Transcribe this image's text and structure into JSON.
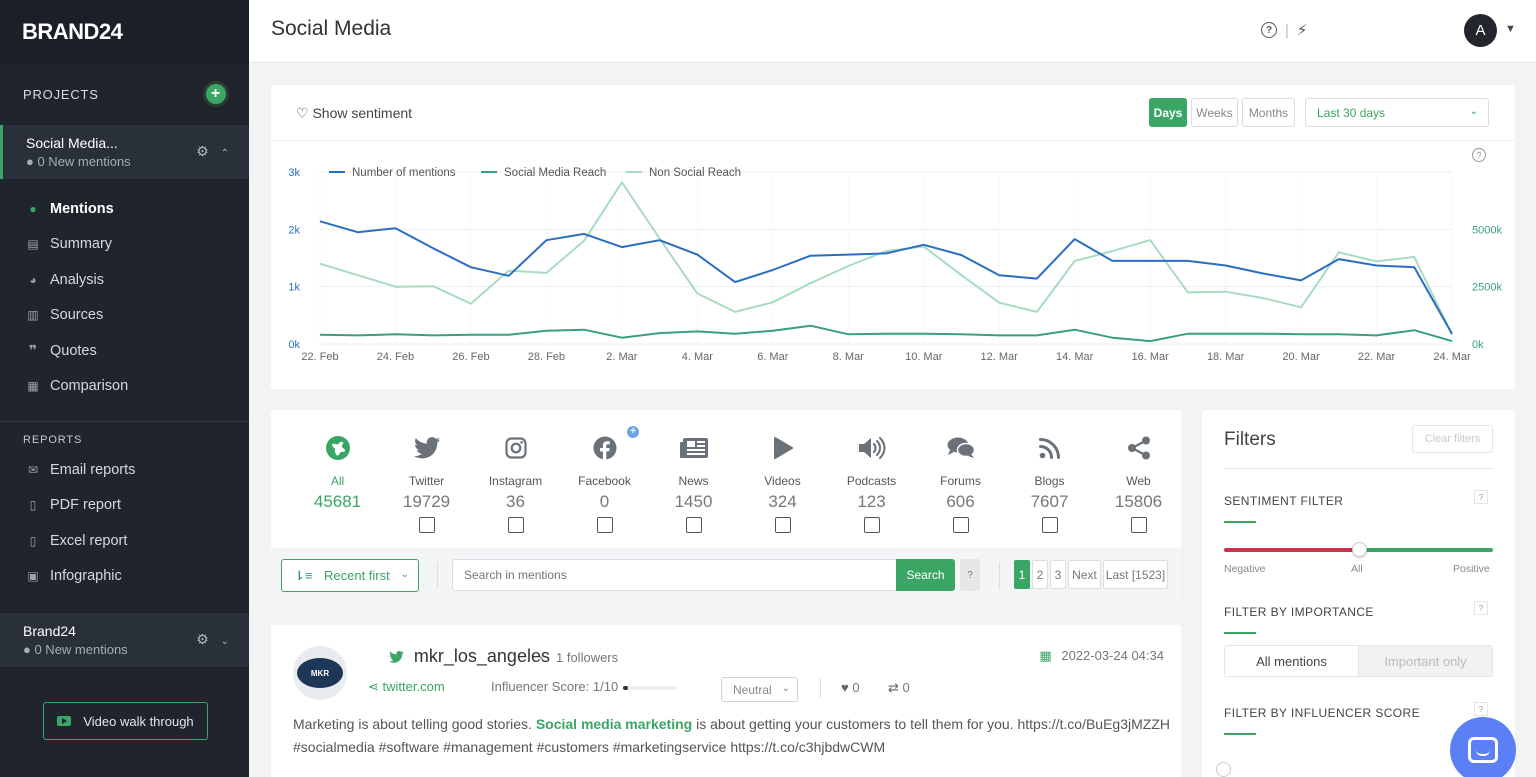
{
  "sidebar": {
    "logo": "BRAND24",
    "projects_head": "PROJECTS",
    "add_symbol": "+",
    "project1": {
      "name": "Social Media...",
      "mentions": "● 0 New mentions"
    },
    "nav": [
      {
        "label": "Mentions",
        "icon": "chat-icon"
      },
      {
        "label": "Summary",
        "icon": "document-icon"
      },
      {
        "label": "Analysis",
        "icon": "pie-chart-icon"
      },
      {
        "label": "Sources",
        "icon": "columns-icon"
      },
      {
        "label": "Quotes",
        "icon": "quote-icon"
      },
      {
        "label": "Comparison",
        "icon": "compare-icon"
      }
    ],
    "reports_head": "REPORTS",
    "reports": [
      {
        "label": "Email reports",
        "icon": "envelope-icon"
      },
      {
        "label": "PDF report",
        "icon": "pdf-icon"
      },
      {
        "label": "Excel report",
        "icon": "excel-icon"
      },
      {
        "label": "Infographic",
        "icon": "image-icon"
      }
    ],
    "project2": {
      "name": "Brand24",
      "mentions": "● 0 New mentions"
    },
    "video_label": "Video walk through"
  },
  "topbar": {
    "title": "Social Media",
    "avatar_letter": "A"
  },
  "chart_controls": {
    "show_sentiment": "Show sentiment",
    "periods": [
      "Days",
      "Weeks",
      "Months"
    ],
    "range": "Last 30 days",
    "help": "?"
  },
  "colors": {
    "accent": "#3aa564",
    "mentions_line": "#2a6ec1",
    "social_reach_line": "#3aa07a",
    "non_social_reach_line": "#a8dcc0",
    "negative": "#c9344a"
  },
  "chart_data": {
    "type": "line",
    "x": [
      "22. Feb",
      "23. Feb",
      "24. Feb",
      "25. Feb",
      "26. Feb",
      "27. Feb",
      "28. Feb",
      "1. Mar",
      "2. Mar",
      "3. Mar",
      "4. Mar",
      "5. Mar",
      "6. Mar",
      "7. Mar",
      "8. Mar",
      "9. Mar",
      "10. Mar",
      "11. Mar",
      "12. Mar",
      "13. Mar",
      "14. Mar",
      "15. Mar",
      "16. Mar",
      "17. Mar",
      "18. Mar",
      "19. Mar",
      "20. Mar",
      "21. Mar",
      "22. Mar",
      "23. Mar",
      "24. Mar"
    ],
    "x_ticks": [
      "22. Feb",
      "24. Feb",
      "26. Feb",
      "28. Feb",
      "2. Mar",
      "4. Mar",
      "6. Mar",
      "8. Mar",
      "10. Mar",
      "12. Mar",
      "14. Mar",
      "16. Mar",
      "18. Mar",
      "20. Mar",
      "22. Mar",
      "24. Mar"
    ],
    "y_left_ticks": [
      "0k",
      "1k",
      "2k",
      "3k"
    ],
    "y_right_ticks": [
      "0k",
      "2500k",
      "5000k"
    ],
    "ylim_left": [
      0,
      3000
    ],
    "ylim_right": [
      0,
      7500000
    ],
    "grid": true,
    "legend_position": "top-left",
    "series": [
      {
        "name": "Number of mentions",
        "axis": "left",
        "values": [
          2140,
          1950,
          2020,
          1670,
          1340,
          1190,
          1810,
          1920,
          1690,
          1810,
          1560,
          1080,
          1290,
          1540,
          1560,
          1580,
          1730,
          1550,
          1200,
          1140,
          1830,
          1450,
          1450,
          1450,
          1370,
          1230,
          1110,
          1480,
          1370,
          1340,
          180
        ]
      },
      {
        "name": "Social Media Reach",
        "axis": "left",
        "values": [
          160,
          150,
          170,
          150,
          160,
          160,
          230,
          250,
          110,
          190,
          220,
          180,
          230,
          320,
          170,
          180,
          180,
          170,
          150,
          150,
          250,
          110,
          50,
          180,
          180,
          180,
          170,
          170,
          150,
          240,
          50
        ]
      },
      {
        "name": "Non Social Reach",
        "axis": "right",
        "values": [
          3500000,
          3000000,
          2500000,
          2520000,
          1760000,
          3200000,
          3100000,
          4500000,
          7050000,
          4600000,
          2200000,
          1400000,
          1820000,
          2650000,
          3400000,
          4050000,
          4250000,
          3000000,
          1800000,
          1400000,
          3620000,
          4050000,
          4530000,
          2250000,
          2280000,
          2000000,
          1600000,
          4000000,
          3600000,
          3800000,
          400000
        ]
      }
    ]
  },
  "sources": [
    {
      "label": "All",
      "count": "45681",
      "icon": "globe-icon"
    },
    {
      "label": "Twitter",
      "count": "19729",
      "icon": "twitter-icon"
    },
    {
      "label": "Instagram",
      "count": "36",
      "icon": "instagram-icon"
    },
    {
      "label": "Facebook",
      "count": "0",
      "icon": "facebook-icon"
    },
    {
      "label": "News",
      "count": "1450",
      "icon": "newspaper-icon"
    },
    {
      "label": "Videos",
      "count": "324",
      "icon": "play-icon"
    },
    {
      "label": "Podcasts",
      "count": "123",
      "icon": "speaker-icon"
    },
    {
      "label": "Forums",
      "count": "606",
      "icon": "forum-icon"
    },
    {
      "label": "Blogs",
      "count": "7607",
      "icon": "rss-icon"
    },
    {
      "label": "Web",
      "count": "15806",
      "icon": "share-icon"
    }
  ],
  "facebook_plus": "+",
  "toolbar": {
    "sort_label": "Recent first",
    "search_placeholder": "Search in mentions",
    "search_btn": "Search",
    "help": "?",
    "pages": [
      "1",
      "2",
      "3",
      "Next",
      "Last [1523]"
    ]
  },
  "mention": {
    "avatar_text": "MKR",
    "author": "mkr_los_angeles",
    "dot": "•",
    "followers": "1 followers",
    "date": "2022-03-24 04:34",
    "source": "twitter.com",
    "influencer": "Influencer Score: 1/10",
    "influencer_fraction": 0.1,
    "sentiment": "Neutral",
    "likes": "0",
    "shares": "0",
    "text_pre": "Marketing is about telling good stories. ",
    "text_hl": "Social media marketing",
    "text_post": " is about getting your customers to tell them for you. https://t.co/BuEg3jMZZH #socialmedia #software #management #customers #marketingservice https://t.co/c3hjbdwCWM"
  },
  "filters": {
    "title": "Filters",
    "clear": "Clear filters",
    "sentiment_head": "SENTIMENT FILTER",
    "negative": "Negative",
    "all": "All",
    "positive": "Positive",
    "importance_head": "FILTER BY IMPORTANCE",
    "all_mentions": "All mentions",
    "important_only": "Important only",
    "influencer_head": "FILTER BY INFLUENCER SCORE",
    "help": "?"
  }
}
